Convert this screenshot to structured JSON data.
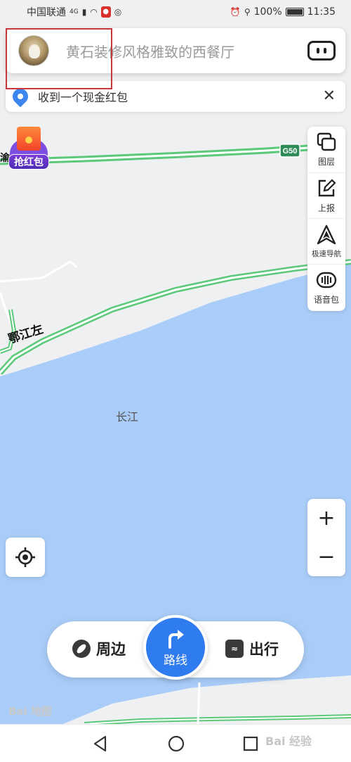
{
  "status_bar": {
    "carrier": "中国联通",
    "network": "4G",
    "battery": "100%",
    "time": "11:35"
  },
  "search": {
    "placeholder": "黄石装修风格雅致的西餐厅"
  },
  "notice": {
    "text": "收到一个现金红包"
  },
  "red_packet": {
    "label": "抢红包"
  },
  "map": {
    "highway_shield": "G50",
    "road_label": "鄂江左",
    "river_label": "长江",
    "road_end_label": "渝",
    "colors": {
      "water": "#a9cdf8",
      "land": "#eef0f2",
      "road": "#5cc97a",
      "accent": "#2f7bf0"
    }
  },
  "tools": [
    {
      "label": "图层",
      "icon": "layers-icon"
    },
    {
      "label": "上报",
      "icon": "edit-icon"
    },
    {
      "label": "极速导航",
      "icon": "navigation-icon"
    },
    {
      "label": "语音包",
      "icon": "voice-pack-icon"
    }
  ],
  "zoom": {
    "plus": "+",
    "minus": "−"
  },
  "bottom_bar": {
    "nearby": "周边",
    "route": "路线",
    "travel": "出行"
  },
  "watermarks": {
    "left": "Bai 地图",
    "right": "Bai 经验"
  }
}
